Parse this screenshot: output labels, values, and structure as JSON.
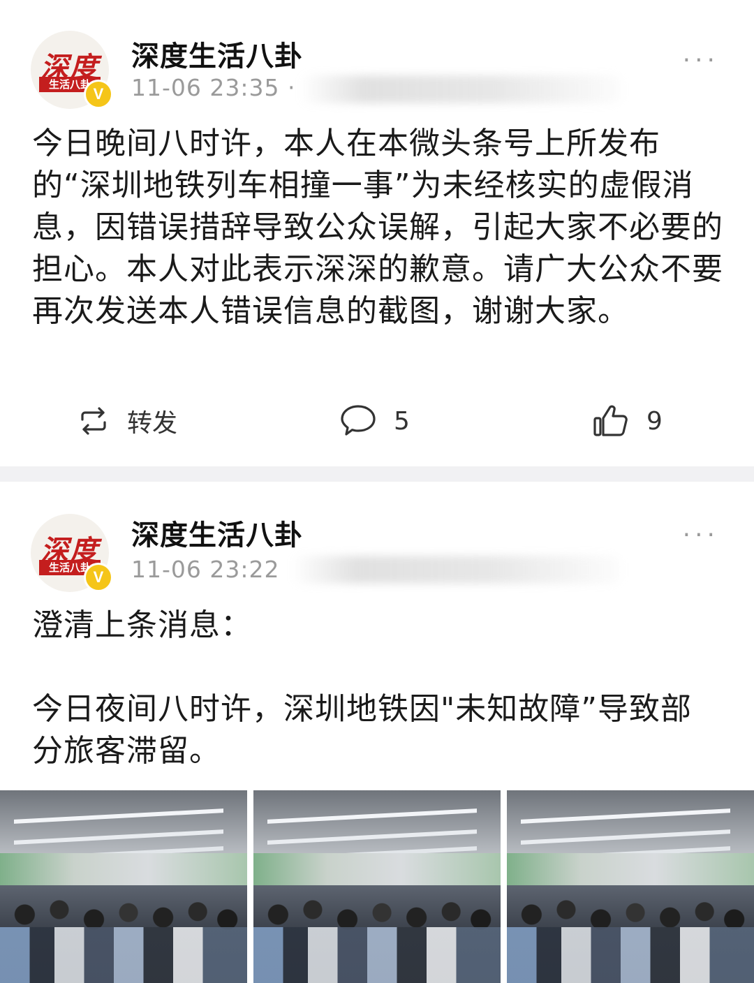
{
  "posts": [
    {
      "author": "深度生活八卦",
      "avatar_text_top": "深度",
      "avatar_text_band": "生活八卦",
      "verified_mark": "V",
      "timestamp": "11-06 23:35",
      "meta_separator": "·",
      "source_obscured": "南方都市报 / 记者",
      "more_icon": "···",
      "body": "今日晚间八时许，本人在本微头条号上所发布的“深圳地铁列车相撞一事”为未经核实的虚假消息，因错误措辞导致公众误解，引起大家不必要的担心。本人对此表示深深的歉意。请广大公众不要再次发送本人错误信息的截图，谢谢大家。",
      "actions": {
        "repost_label": "转发",
        "comment_count": "5",
        "like_count": "9"
      }
    },
    {
      "author": "深度生活八卦",
      "avatar_text_top": "深度",
      "avatar_text_band": "生活八卦",
      "verified_mark": "V",
      "timestamp": "11-06 23:22",
      "more_icon": "···",
      "body_line_1": "澄清上条消息：",
      "body": "今日夜间八时许，深圳地铁因\"未知故障”导致部分旅客滞留。",
      "photos": [
        {
          "subject": "crowded-subway-station-photo"
        },
        {
          "subject": "crowded-subway-station-photo"
        },
        {
          "subject": "crowded-subway-station-photo"
        }
      ]
    }
  ],
  "icons": {
    "repost": "repost-icon",
    "comment": "comment-icon",
    "like": "thumbs-up-icon",
    "verified": "verified-badge-icon",
    "more": "more-options-icon"
  }
}
